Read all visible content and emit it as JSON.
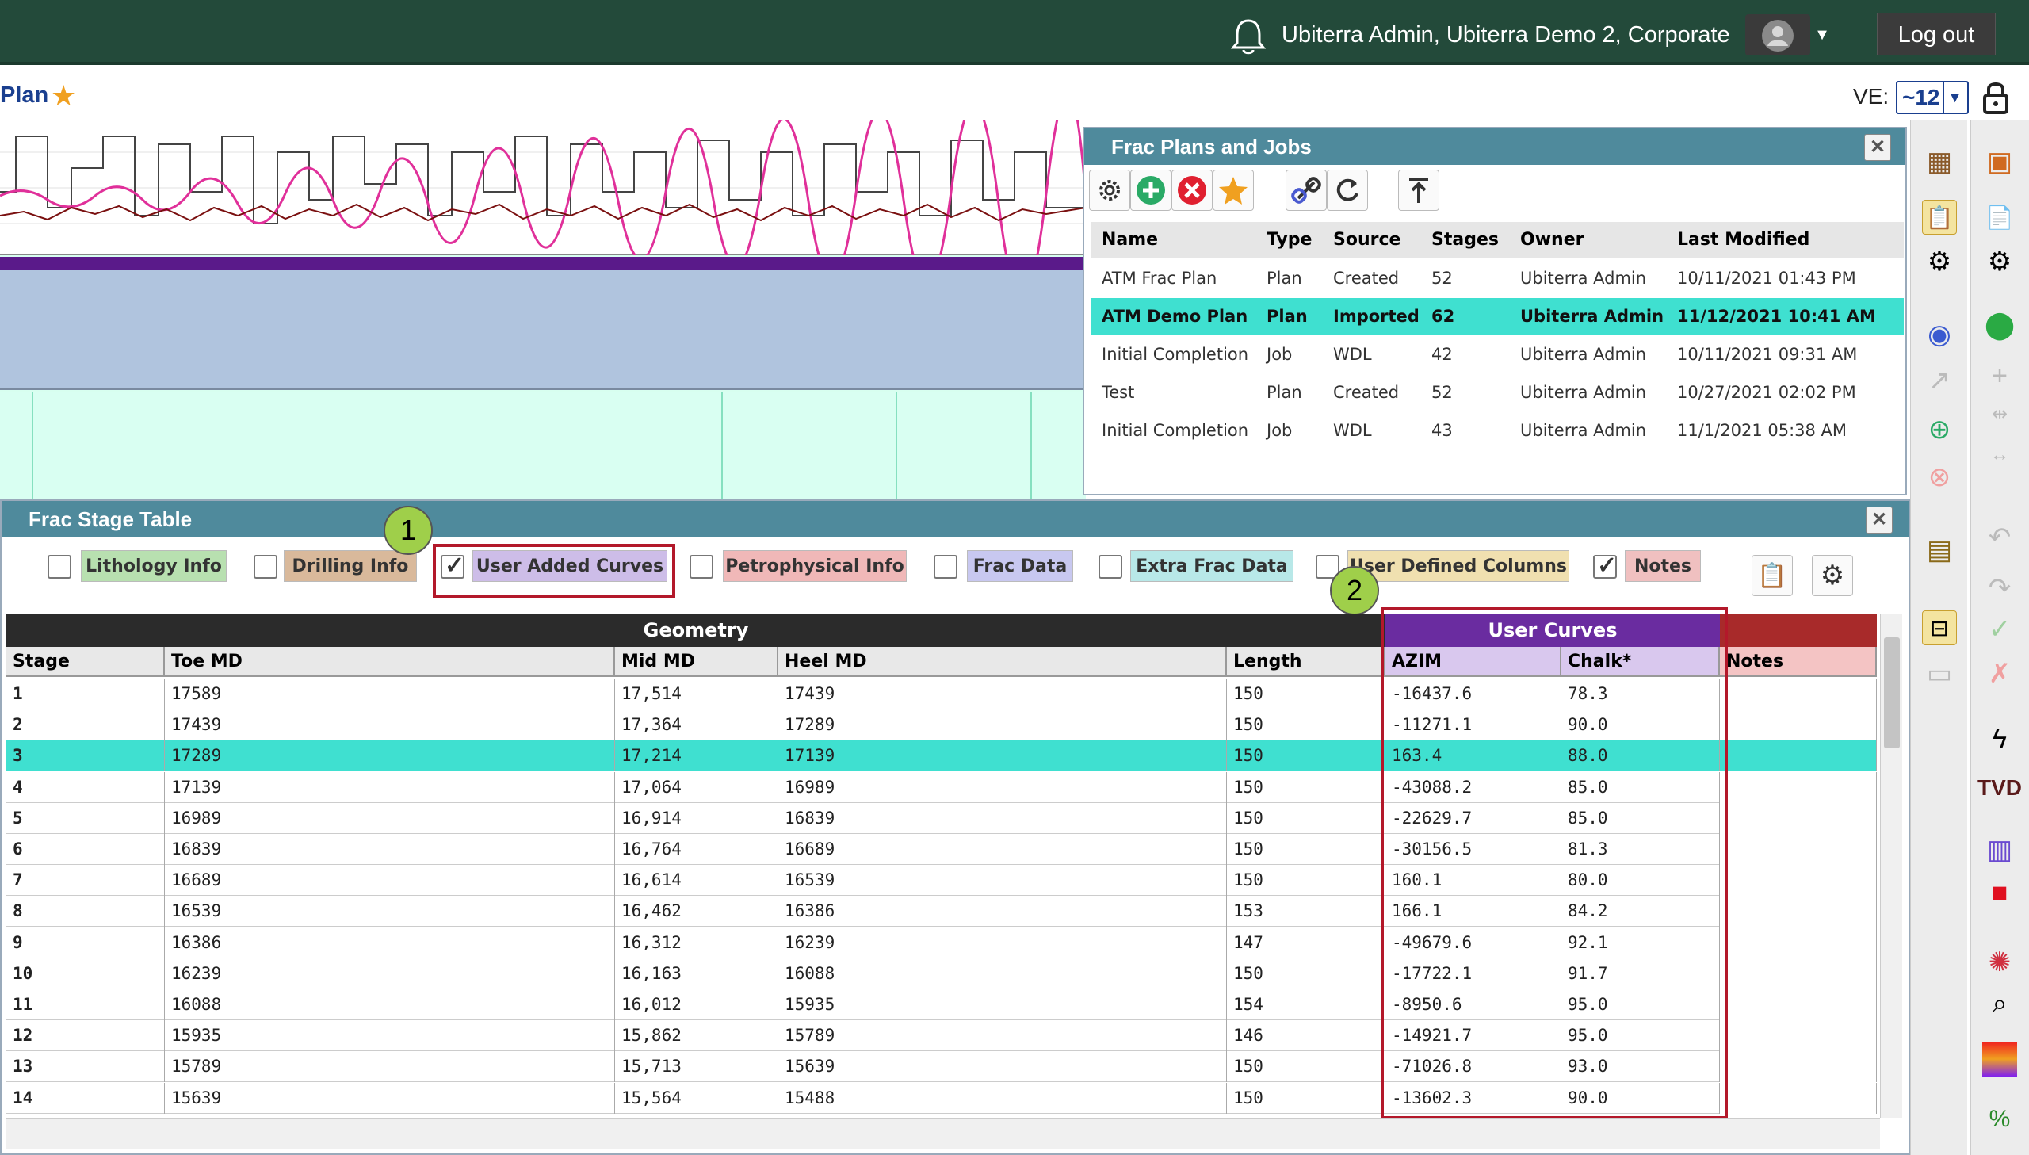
{
  "topbar": {
    "user_text": "Ubiterra Admin, Ubiterra Demo 2, Corporate",
    "logout_label": "Log out",
    "bell_icon": "bell-icon",
    "avatar_icon": "user-avatar-icon"
  },
  "planbar": {
    "title": "Plan",
    "ve_label": "VE:",
    "ve_value": "~12",
    "lock_icon": "lock-icon"
  },
  "frac_plans": {
    "title": "Frac Plans and Jobs",
    "toolbar_icons": [
      "gear-icon",
      "add-icon",
      "delete-icon",
      "star-icon",
      "link-icon",
      "refresh-icon",
      "upload-icon"
    ],
    "columns": [
      "Name",
      "Type",
      "Source",
      "Stages",
      "Owner",
      "Last Modified"
    ],
    "rows": [
      {
        "name": "ATM Frac Plan",
        "type": "Plan",
        "source": "Created",
        "stages": "52",
        "owner": "Ubiterra Admin",
        "modified": "10/11/2021 01:43 PM",
        "selected": false
      },
      {
        "name": "ATM Demo Plan",
        "type": "Plan",
        "source": "Imported",
        "stages": "62",
        "owner": "Ubiterra Admin",
        "modified": "11/12/2021 10:41 AM",
        "selected": true
      },
      {
        "name": "Initial Completion",
        "type": "Job",
        "source": "WDL",
        "stages": "42",
        "owner": "Ubiterra Admin",
        "modified": "10/11/2021 09:31 AM",
        "selected": false
      },
      {
        "name": "Test",
        "type": "Plan",
        "source": "Created",
        "stages": "52",
        "owner": "Ubiterra Admin",
        "modified": "10/27/2021 02:02 PM",
        "selected": false
      },
      {
        "name": "Initial Completion",
        "type": "Job",
        "source": "WDL",
        "stages": "43",
        "owner": "Ubiterra Admin",
        "modified": "11/1/2021 05:38 AM",
        "selected": false
      }
    ]
  },
  "frac_stage": {
    "title": "Frac Stage Table",
    "callouts": [
      "1",
      "2"
    ],
    "options": [
      {
        "label": "Lithology Info",
        "checked": false,
        "color": "#b8e0b0"
      },
      {
        "label": "Drilling Info",
        "checked": false,
        "color": "#d9b99b"
      },
      {
        "label": "User Added Curves",
        "checked": true,
        "color": "#cdbde8"
      },
      {
        "label": "Petrophysical Info",
        "checked": false,
        "color": "#f0b8b8"
      },
      {
        "label": "Frac Data",
        "checked": false,
        "color": "#c8c8f0"
      },
      {
        "label": "Extra Frac Data",
        "checked": false,
        "color": "#b8e8e8"
      },
      {
        "label": "User Defined Columns",
        "checked": false,
        "color": "#f0e0b0"
      },
      {
        "label": "Notes",
        "checked": true,
        "color": "#f0c0c0"
      }
    ],
    "groups": {
      "geometry": "Geometry",
      "user_curves": "User Curves",
      "notes": ""
    },
    "columns": [
      "Stage",
      "Toe MD",
      "Mid MD",
      "Heel MD",
      "Length",
      "AZIM",
      "Chalk*",
      "Notes"
    ],
    "rows": [
      [
        "1",
        "17589",
        "17,514",
        "17439",
        "150",
        "-16437.6",
        "78.3",
        ""
      ],
      [
        "2",
        "17439",
        "17,364",
        "17289",
        "150",
        "-11271.1",
        "90.0",
        ""
      ],
      [
        "3",
        "17289",
        "17,214",
        "17139",
        "150",
        "163.4",
        "88.0",
        ""
      ],
      [
        "4",
        "17139",
        "17,064",
        "16989",
        "150",
        "-43088.2",
        "85.0",
        ""
      ],
      [
        "5",
        "16989",
        "16,914",
        "16839",
        "150",
        "-22629.7",
        "85.0",
        ""
      ],
      [
        "6",
        "16839",
        "16,764",
        "16689",
        "150",
        "-30156.5",
        "81.3",
        ""
      ],
      [
        "7",
        "16689",
        "16,614",
        "16539",
        "150",
        "160.1",
        "80.0",
        ""
      ],
      [
        "8",
        "16539",
        "16,462",
        "16386",
        "153",
        "166.1",
        "84.2",
        ""
      ],
      [
        "9",
        "16386",
        "16,312",
        "16239",
        "147",
        "-49679.6",
        "92.1",
        ""
      ],
      [
        "10",
        "16239",
        "16,163",
        "16088",
        "150",
        "-17722.1",
        "91.7",
        ""
      ],
      [
        "11",
        "16088",
        "16,012",
        "15935",
        "154",
        "-8950.6",
        "95.0",
        ""
      ],
      [
        "12",
        "15935",
        "15,862",
        "15789",
        "146",
        "-14921.7",
        "95.0",
        ""
      ],
      [
        "13",
        "15789",
        "15,713",
        "15639",
        "150",
        "-71026.8",
        "93.0",
        ""
      ],
      [
        "14",
        "15639",
        "15,564",
        "15488",
        "150",
        "-13602.3",
        "90.0",
        ""
      ]
    ],
    "selected_row": 2
  },
  "right_toolbar_2": {
    "tvd_label": "TVD"
  },
  "colors": {
    "topbar": "#234a3a",
    "panel_header": "#4f8a9c",
    "selection": "#3fe0d0",
    "geometry_header": "#2b2b2b",
    "user_curves_header": "#6a2ca0",
    "notes_header": "#a82a2a",
    "highlight_box": "#b3182a"
  }
}
